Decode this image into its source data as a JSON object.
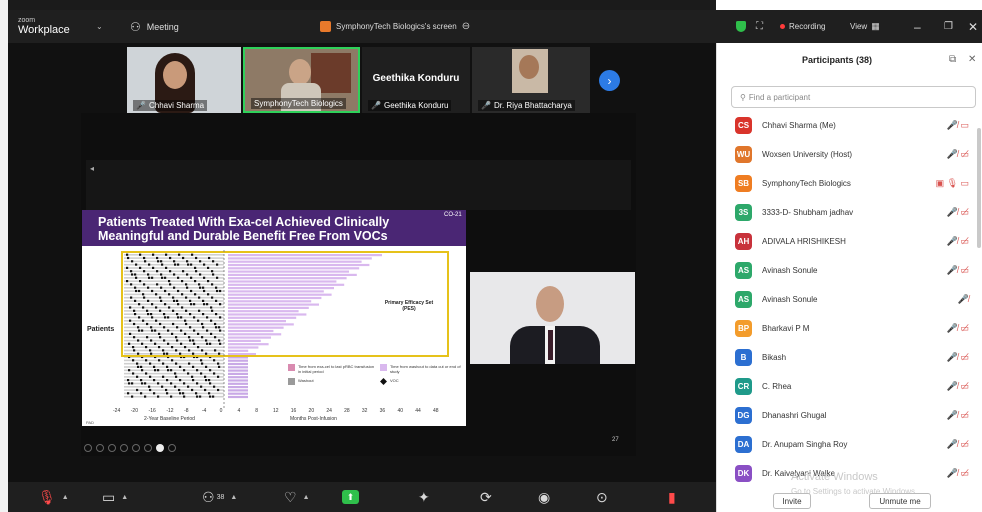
{
  "titlebar": {
    "brand_small": "zoom",
    "brand": "Workplace",
    "meeting_label": "Meeting",
    "share_label": "SymphonyTech Biologics's screen",
    "recording_label": "Recording",
    "view_label": "View"
  },
  "thumbnails": [
    {
      "name": "Chhavi Sharma"
    },
    {
      "name": "SymphonyTech Biologics"
    },
    {
      "name": "Geethika Konduru",
      "display_name": "Geethika Konduru"
    },
    {
      "name": "Dr. Riya Bhattacharya"
    }
  ],
  "slide": {
    "corner_code": "CO-21",
    "title_line1": "Patients Treated With Exa-cel Achieved Clinically",
    "title_line2": "Meaningful and Durable Benefit Free From VOCs",
    "y_label": "Patients",
    "annotation": "Primary Efficacy Set (PES)",
    "legend": [
      {
        "label": "Time from exa-cel to last pRBC transfusion in initial period",
        "color": "#d98bb0"
      },
      {
        "label": "Time from washout to data cut or end of study",
        "color": "#d9b8ee"
      },
      {
        "label": "Washout",
        "color": "#9a9a9a"
      },
      {
        "label": "VOC",
        "color": "#111111"
      }
    ],
    "x_ticks": [
      "-24",
      "-20",
      "-16",
      "-12",
      "-8",
      "-4",
      "0",
      "4",
      "8",
      "12",
      "16",
      "20",
      "24",
      "28",
      "32",
      "36",
      "40",
      "44",
      "48"
    ],
    "x_label_left": "2-Year Baseline Period",
    "x_label_right": "Months Post-Infusion",
    "footer_left": "PAD",
    "page_number": "27"
  },
  "participants": {
    "title": "Participants (38)",
    "search_placeholder": "Find a participant",
    "list": [
      {
        "initials": "CS",
        "name": "Chhavi Sharma (Me)",
        "color": "#d9342b",
        "icons": "🎤̸ ▭"
      },
      {
        "initials": "WU",
        "name": "Woxsen University (Host)",
        "color": "#e0762b",
        "icons": "🎤̸ ▭̸"
      },
      {
        "initials": "SB",
        "name": "SymphonyTech Biologics",
        "color": "#ef7d22",
        "icons": "▣ 🎙 ▭"
      },
      {
        "initials": "3S",
        "name": "3333-D- Shubham jadhav",
        "color": "#2da86a",
        "icons": "🎤̸ ▭̸"
      },
      {
        "initials": "AH",
        "name": "ADIVALA HRISHIKESH",
        "color": "#c8323b",
        "icons": "🎤̸ ▭̸"
      },
      {
        "initials": "AS",
        "name": "Avinash Sonule",
        "color": "#2da86a",
        "icons": "🎤̸ ▭̸"
      },
      {
        "initials": "AS",
        "name": "Avinash Sonule",
        "color": "#2da86a",
        "icons": "🎤̸"
      },
      {
        "initials": "BP",
        "name": "Bharkavi P M",
        "color": "#f39c2b",
        "icons": "🎤̸ ▭̸"
      },
      {
        "initials": "B",
        "name": "Bikash",
        "color": "#2c6fd1",
        "icons": "🎤̸ ▭̸"
      },
      {
        "initials": "CR",
        "name": "C. Rhea",
        "color": "#1f9a8a",
        "icons": "🎤̸ ▭̸"
      },
      {
        "initials": "DG",
        "name": "Dhanashri Ghugal",
        "color": "#2c6fd1",
        "icons": "🎤̸ ▭̸"
      },
      {
        "initials": "DA",
        "name": "Dr. Anupam Singha Roy",
        "color": "#2c6fd1",
        "icons": "🎤̸ ▭̸"
      },
      {
        "initials": "DK",
        "name": "Dr. Kaivalyani Walke",
        "color": "#8a4fc4",
        "icons": "🎤̸ ▭̸"
      }
    ],
    "invite_label": "Invite",
    "unmute_label": "Unmute me",
    "watermark_line1": "Activate Windows",
    "watermark_line2": "Go to Settings to activate Windows."
  },
  "toolbar": {
    "participants_count": "38"
  }
}
